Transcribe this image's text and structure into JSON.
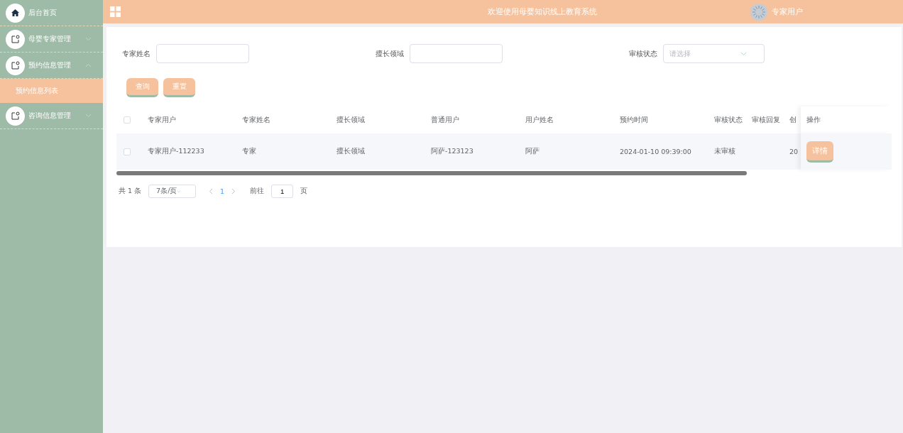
{
  "sidebar": {
    "items": [
      {
        "label": "后台首页"
      },
      {
        "label": "母婴专家管理",
        "expanded": false
      },
      {
        "label": "预约信息管理",
        "expanded": true,
        "children": [
          {
            "label": "预约信息列表",
            "selected": true
          }
        ]
      },
      {
        "label": "咨询信息管理",
        "expanded": false
      }
    ]
  },
  "header": {
    "title": "欢迎使用母婴知识线上教育系统",
    "user": "专家用户"
  },
  "filters": [
    {
      "label": "专家姓名",
      "kind": "input"
    },
    {
      "label": "擅长领域",
      "kind": "input"
    },
    {
      "label": "审核状态",
      "kind": "select",
      "placeholder": "请选择"
    }
  ],
  "buttons": [
    "查询",
    "重置"
  ],
  "table": {
    "all_checked": false,
    "columns": [
      "专家用户",
      "专家姓名",
      "擅长领域",
      "普通用户",
      "用户姓名",
      "预约时间",
      "审核状态",
      "审核回复",
      "创"
    ],
    "action_column": "操作",
    "rows": [
      {
        "checked": false,
        "cells": [
          "专家用户-112233",
          "专家",
          "擅长领域",
          "阿萨-123123",
          "阿萨",
          "2024-01-10 09:39:00",
          "未审核",
          "",
          "20"
        ],
        "action": "详情"
      }
    ]
  },
  "pagination": {
    "total": "共 1 条",
    "page_size": "7条/页",
    "pages": [
      {
        "label": "1",
        "selected": true
      }
    ],
    "goto_label": "前往",
    "goto_value": "1",
    "goto_suffix": "页"
  }
}
